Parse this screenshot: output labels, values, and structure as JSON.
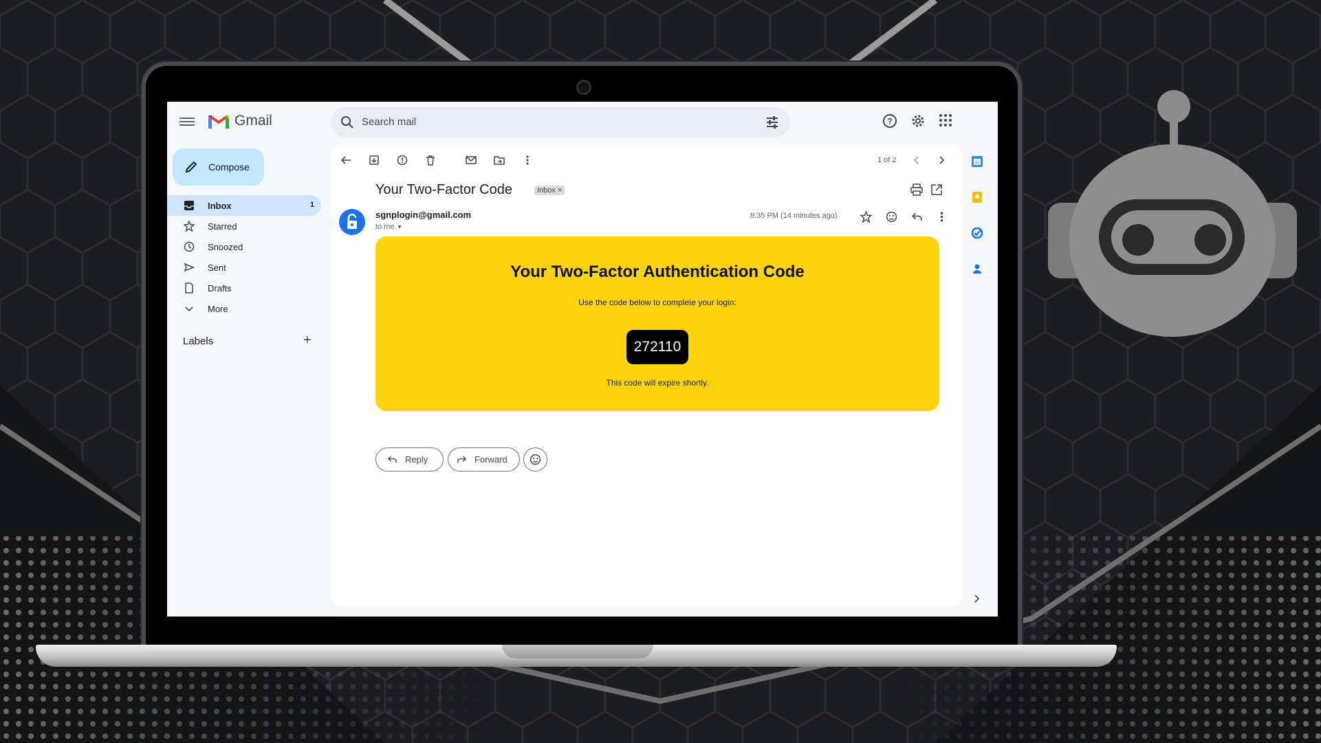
{
  "app": {
    "name": "Gmail"
  },
  "search": {
    "placeholder": "Search mail"
  },
  "compose": {
    "label": "Compose"
  },
  "nav": {
    "items": [
      {
        "label": "Inbox",
        "count": "1",
        "icon": "inbox-icon",
        "active": true
      },
      {
        "label": "Starred",
        "icon": "star-icon"
      },
      {
        "label": "Snoozed",
        "icon": "clock-icon"
      },
      {
        "label": "Sent",
        "icon": "send-icon"
      },
      {
        "label": "Drafts",
        "icon": "draft-icon"
      },
      {
        "label": "More",
        "icon": "chevron-down-icon"
      }
    ]
  },
  "labels": {
    "heading": "Labels",
    "add": "+"
  },
  "toolbar": {
    "pager": "1 of 2"
  },
  "email": {
    "subject": "Your Two-Factor Code",
    "tag": "Inbox ×",
    "sender": "sgnplogin@gmail.com",
    "recipient": "to me",
    "time": "9:35 PM (14 minutes ago)",
    "body": {
      "heading": "Your Two-Factor Authentication Code",
      "instruction": "Use the code below to complete your login:",
      "code": "272110",
      "expiry": "This code will expire shortly."
    }
  },
  "actions": {
    "reply": "Reply",
    "forward": "Forward"
  },
  "colors": {
    "card": "#fdd40f",
    "compose": "#c2e7ff",
    "active_nav": "#d3e3fd",
    "avatar": "#1a73e8"
  }
}
